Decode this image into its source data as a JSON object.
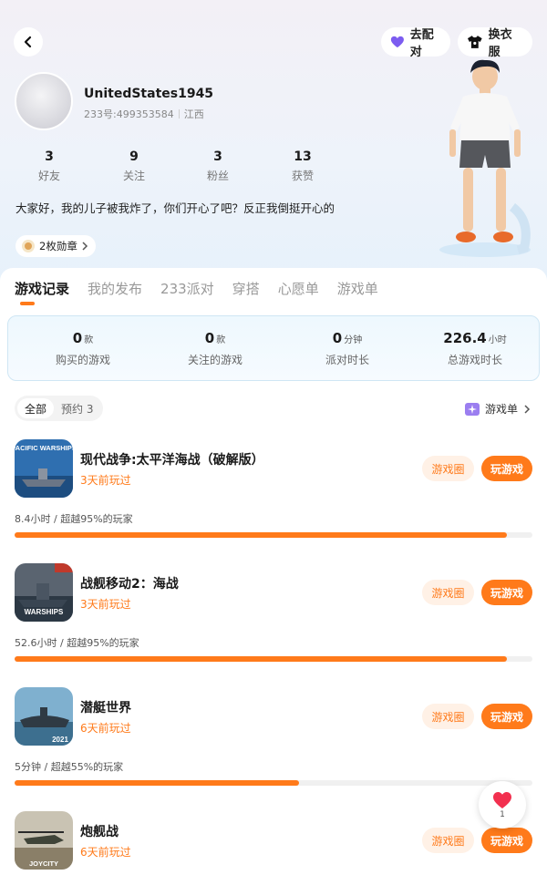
{
  "header": {
    "match_label": "去配对",
    "outfit_label": "换衣服"
  },
  "profile": {
    "username": "UnitedStates1945",
    "user_id": "233号:499353584",
    "region": "江西",
    "stats": [
      {
        "value": "3",
        "label": "好友"
      },
      {
        "value": "9",
        "label": "关注"
      },
      {
        "value": "3",
        "label": "粉丝"
      },
      {
        "value": "13",
        "label": "获赞"
      }
    ],
    "bio": "大家好，我的儿子被我炸了，你们开心了吧？反正我倒挺开心的",
    "medal_label": "2枚勋章"
  },
  "tabs": [
    "游戏记录",
    "我的发布",
    "233派对",
    "穿搭",
    "心愿单",
    "游戏单"
  ],
  "summary": [
    {
      "value": "0",
      "unit": "款",
      "label": "购买的游戏"
    },
    {
      "value": "0",
      "unit": "款",
      "label": "关注的游戏"
    },
    {
      "value": "0",
      "unit": "分钟",
      "label": "派对时长"
    },
    {
      "value": "226.4",
      "unit": "小时",
      "label": "总游戏时长"
    }
  ],
  "filters": {
    "all": "全部",
    "reserved": "预约 3",
    "gamelist_link": "游戏单"
  },
  "games": [
    {
      "title": "现代战争:太平洋海战（破解版）",
      "last_played": "3天前玩过",
      "time_text": "8.4小时 / 超越95%的玩家",
      "progress": 0.95,
      "circle_label": "游戏圈",
      "play_label": "玩游戏",
      "icon_text": "PACIFIC WARSHIPS"
    },
    {
      "title": "战舰移动2：海战",
      "last_played": "3天前玩过",
      "time_text": "52.6小时 / 超越95%的玩家",
      "progress": 0.95,
      "circle_label": "游戏圈",
      "play_label": "玩游戏",
      "icon_text": "WARSHIPS"
    },
    {
      "title": "潜艇世界",
      "last_played": "6天前玩过",
      "time_text": "5分钟 / 超越55%的玩家",
      "progress": 0.55,
      "circle_label": "游戏圈",
      "play_label": "玩游戏",
      "icon_text": "2021"
    },
    {
      "title": "炮舰战",
      "last_played": "6天前玩过",
      "time_text": "",
      "progress": null,
      "circle_label": "游戏圈",
      "play_label": "玩游戏",
      "icon_text": "JOYCITY"
    }
  ],
  "like_fab": {
    "count": "1"
  },
  "colors": {
    "accent": "#ff7a1a",
    "accent_light": "#fff1e6"
  }
}
